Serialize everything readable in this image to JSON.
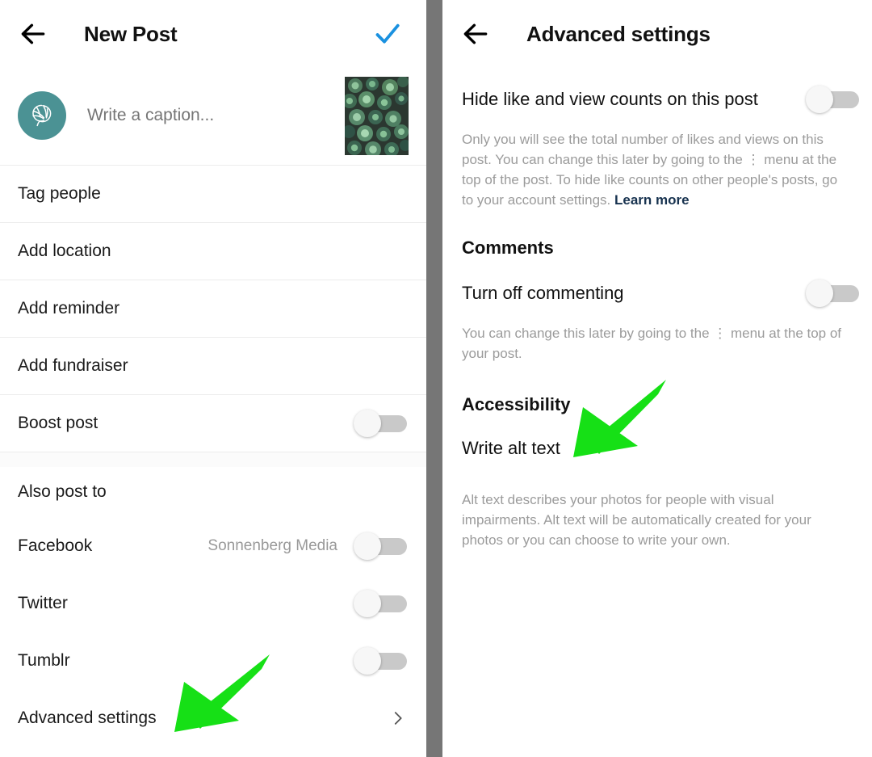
{
  "colors": {
    "accent_blue": "#1a91e0",
    "arrow_green": "#16e016",
    "avatar_teal": "#4b9294",
    "divider_gray": "#767676",
    "link_navy": "#17324f",
    "toggle_track": "#c9c9c9"
  },
  "left_panel": {
    "back_icon": "arrow-left-icon",
    "title": "New Post",
    "confirm_icon": "check-icon",
    "avatar_icon": "leaf-logo-avatar",
    "caption": {
      "value": "",
      "placeholder": "Write a caption..."
    },
    "thumbnail_alt": "succulent-plants-photo",
    "rows": [
      {
        "label": "Tag people",
        "type": "link",
        "value": ""
      },
      {
        "label": "Add location",
        "type": "link",
        "value": ""
      },
      {
        "label": "Add reminder",
        "type": "link",
        "value": ""
      },
      {
        "label": "Add fundraiser",
        "type": "link",
        "value": ""
      },
      {
        "label": "Boost post",
        "type": "toggle",
        "value": "off"
      }
    ],
    "also_post_to": {
      "heading": "Also post to",
      "rows": [
        {
          "label": "Facebook",
          "value": "Sonnenberg Media",
          "toggle": "off"
        },
        {
          "label": "Twitter",
          "value": "",
          "toggle": "off"
        },
        {
          "label": "Tumblr",
          "value": "",
          "toggle": "off"
        }
      ]
    },
    "advanced_settings": {
      "label": "Advanced settings",
      "chevron_icon": "chevron-right-icon"
    }
  },
  "right_panel": {
    "back_icon": "arrow-left-icon",
    "title": "Advanced settings",
    "hide_counts": {
      "label": "Hide like and view counts on this post",
      "toggle": "off",
      "help_text": "Only you will see the total number of likes and views on this post. You can change this later by going to the ⋮ menu at the top of the post. To hide like counts on other people's posts, go to your account settings. ",
      "help_link": "Learn more"
    },
    "comments": {
      "heading": "Comments",
      "turn_off_label": "Turn off commenting",
      "toggle": "off",
      "help_text": "You can change this later by going to the ⋮ menu at the top of your post."
    },
    "accessibility": {
      "heading": "Accessibility",
      "write_alt_text": "Write alt text",
      "help_text": "Alt text describes your photos for people with visual impairments. Alt text will be automatically created for your photos or you can choose to write your own."
    }
  },
  "annotations": [
    {
      "name": "arrow-to-advanced-settings",
      "target": "Advanced settings"
    },
    {
      "name": "arrow-to-write-alt-text",
      "target": "Write alt text"
    }
  ]
}
